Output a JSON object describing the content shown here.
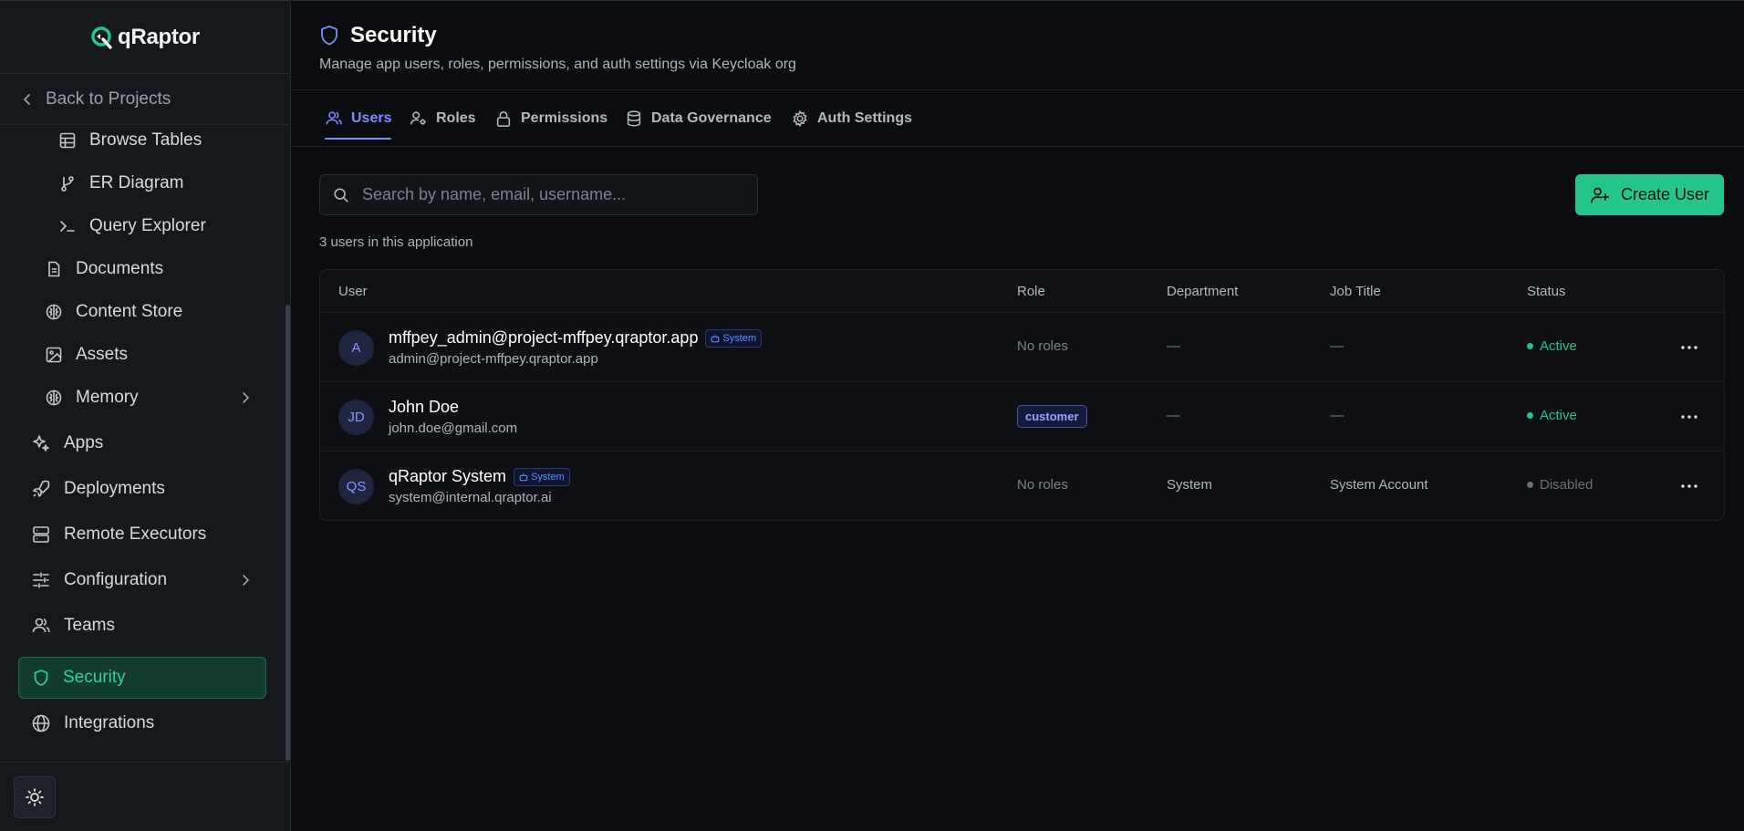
{
  "app": {
    "name": "qRaptor"
  },
  "sidebar": {
    "back_label": "Back to Projects",
    "items": [
      {
        "label": "Browse Tables"
      },
      {
        "label": "ER Diagram"
      },
      {
        "label": "Query Explorer"
      },
      {
        "label": "Documents"
      },
      {
        "label": "Content Store"
      },
      {
        "label": "Assets"
      },
      {
        "label": "Memory"
      },
      {
        "label": "Apps"
      },
      {
        "label": "Deployments"
      },
      {
        "label": "Remote Executors"
      },
      {
        "label": "Configuration"
      },
      {
        "label": "Teams"
      },
      {
        "label": "Security"
      },
      {
        "label": "Integrations"
      }
    ],
    "active_item": "Security"
  },
  "header": {
    "title": "Security",
    "subtitle": "Manage app users, roles, permissions, and auth settings via Keycloak org"
  },
  "tabs": [
    {
      "label": "Users",
      "active": true
    },
    {
      "label": "Roles"
    },
    {
      "label": "Permissions"
    },
    {
      "label": "Data Governance"
    },
    {
      "label": "Auth Settings"
    }
  ],
  "toolbar": {
    "search_placeholder": "Search by name, email, username...",
    "create_label": "Create User"
  },
  "users_count": "3 users in this application",
  "table": {
    "headers": [
      "User",
      "Role",
      "Department",
      "Job Title",
      "Status"
    ],
    "rows": [
      {
        "initials": "A",
        "name": "mffpey_admin@project-mffpey.qraptor.app",
        "badge": "System",
        "email": "admin@project-mffpey.qraptor.app",
        "role": "No roles",
        "department": "—",
        "job_title": "—",
        "status": "Active"
      },
      {
        "initials": "JD",
        "name": "John Doe",
        "email": "john.doe@gmail.com",
        "role": "customer",
        "department": "—",
        "job_title": "—",
        "status": "Active"
      },
      {
        "initials": "QS",
        "name": "qRaptor System",
        "badge": "System",
        "email": "system@internal.qraptor.ai",
        "role": "No roles",
        "department": "System",
        "job_title": "System Account",
        "status": "Disabled"
      }
    ]
  },
  "colors": {
    "accent": "#22c58a",
    "tab_active": "#7f8cff",
    "status_active": "#22c58a",
    "status_disabled": "#6b7178"
  }
}
